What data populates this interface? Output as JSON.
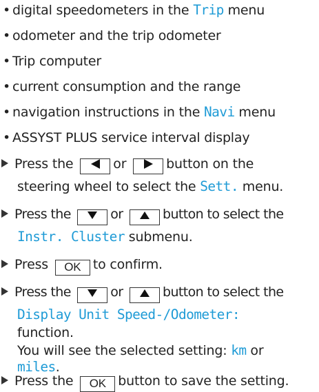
{
  "bullets": [
    {
      "a": "digital speedometers in the ",
      "d": "Trip",
      "b": " menu"
    },
    {
      "a": "odometer and the trip odometer"
    },
    {
      "a": "Trip computer"
    },
    {
      "a": "current consumption and the range"
    },
    {
      "a": "navigation instructions in the ",
      "d": "Navi",
      "b": " menu"
    },
    {
      "a": "ASSYST PLUS service interval display"
    }
  ],
  "step1": {
    "press": "Press the",
    "or": "or",
    "rest": "button on the",
    "line2a": "steering wheel to select the ",
    "disp": "Sett.",
    "line2b": " menu."
  },
  "step2": {
    "press": "Press the",
    "or": "or",
    "rest": "button to select the",
    "disp": "Instr. Cluster",
    "line2b": " submenu."
  },
  "step3": {
    "press": "Press",
    "key": "OK",
    "rest": "to confirm."
  },
  "step4": {
    "press": "Press the",
    "or": "or",
    "rest": "button to select the",
    "disp": "Display Unit Speed-/Odometer:",
    "function": "function.",
    "note": "You will see the selected setting: ",
    "km": "km",
    "or2": " or",
    "miles": "miles",
    "dot": "."
  },
  "step5": {
    "press": "Press the",
    "key": "OK",
    "rest": "button to save the setting."
  },
  "colors": {
    "display_text": "#1f9bd6",
    "body_text": "#222222",
    "key_border": "#333333"
  },
  "icons": {
    "bullet": "bullet-dot",
    "step": "right-triangle-arrow",
    "left": "left-triangle-icon",
    "right": "right-triangle-icon",
    "down": "down-triangle-icon",
    "up": "up-triangle-icon"
  }
}
